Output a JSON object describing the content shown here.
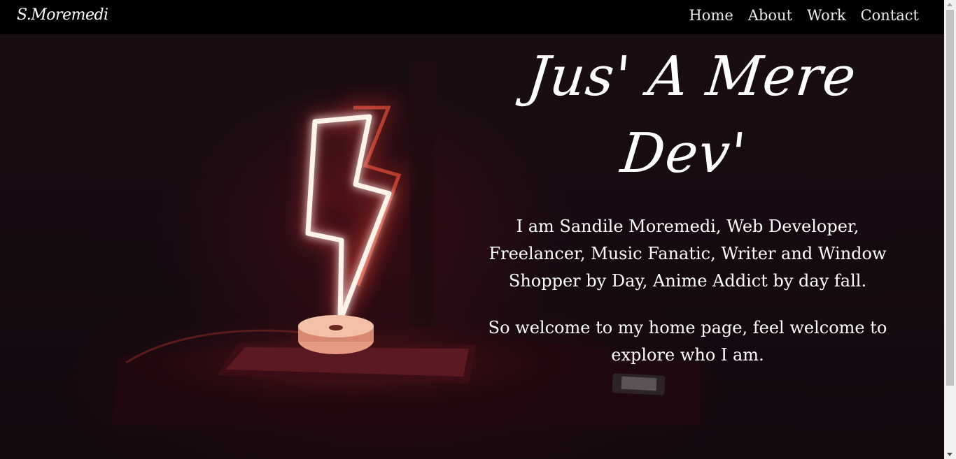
{
  "nav": {
    "brand": "S.Moremedi",
    "links": [
      "Home",
      "About",
      "Work",
      "Contact"
    ]
  },
  "hero": {
    "title": "Jus' A Mere Dev'",
    "paragraph1": "I am Sandile Moremedi, Web Developer, Freelancer, Music Fanatic, Writer and Window Shopper by Day, Anime Addict by day fall.",
    "paragraph2": "So welcome to my home page, feel welcome to explore who I am."
  },
  "colors": {
    "navbar": "#000000",
    "background": "#160a11",
    "neon": "#ff4a3a",
    "text": "#ffffff"
  },
  "icons": {
    "background_image": "neon-lightning-lamp"
  }
}
